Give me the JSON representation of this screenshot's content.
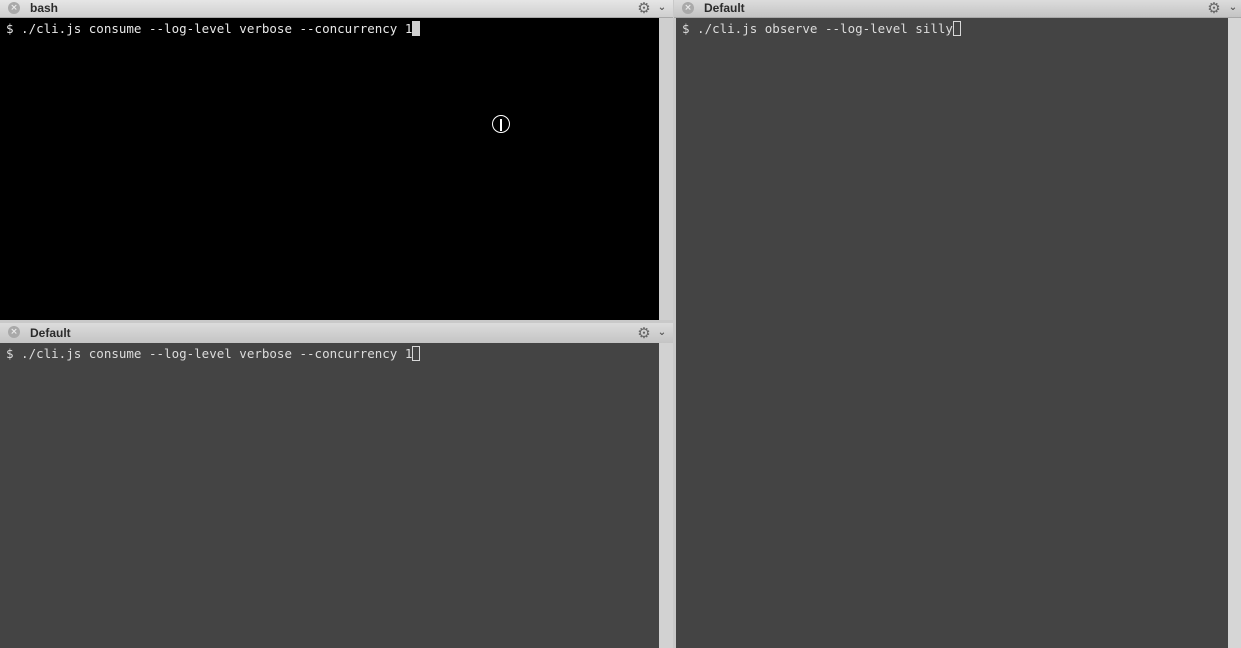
{
  "panes": {
    "top_left": {
      "title": "bash",
      "prompt": "$ ./cli.js consume --log-level verbose --concurrency 1",
      "bg": "#000000"
    },
    "bottom_left": {
      "title": "Default",
      "prompt": "$ ./cli.js consume --log-level verbose --concurrency 1",
      "bg": "#444444"
    },
    "right": {
      "title": "Default",
      "prompt": "$ ./cli.js observe --log-level silly",
      "bg": "#444444"
    }
  },
  "icons": {
    "close": "×",
    "settings": "⚙",
    "chevron": "⌄"
  }
}
